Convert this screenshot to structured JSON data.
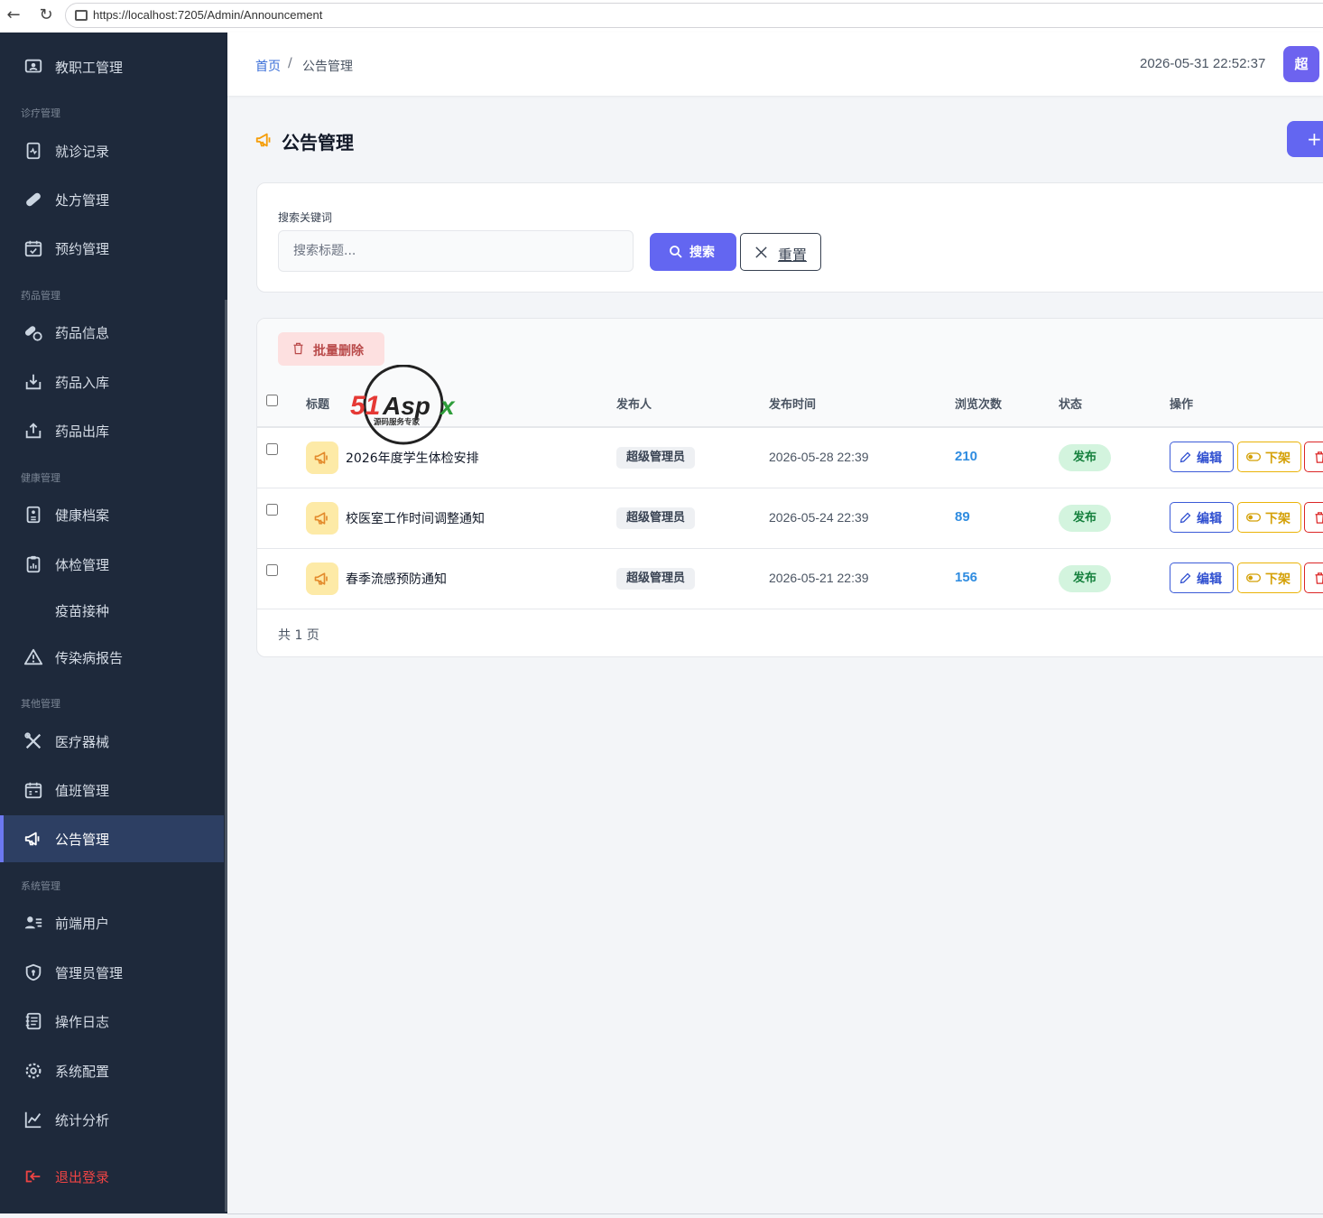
{
  "browser": {
    "url": "https://localhost:7205/Admin/Announcement"
  },
  "sidebar": {
    "items": [
      {
        "label": "教职工管理",
        "icon": "teacher-icon"
      },
      {
        "group": "诊疗管理"
      },
      {
        "label": "就诊记录",
        "icon": "medical-record-icon"
      },
      {
        "label": "处方管理",
        "icon": "capsule-icon"
      },
      {
        "label": "预约管理",
        "icon": "calendar-check-icon"
      },
      {
        "group": "药品管理"
      },
      {
        "label": "药品信息",
        "icon": "pills-icon"
      },
      {
        "label": "药品入库",
        "icon": "box-in-icon"
      },
      {
        "label": "药品出库",
        "icon": "box-out-icon"
      },
      {
        "group": "健康管理"
      },
      {
        "label": "健康档案",
        "icon": "health-file-icon"
      },
      {
        "label": "体检管理",
        "icon": "checkup-icon"
      },
      {
        "label": "疫苗接种",
        "icon": ""
      },
      {
        "label": "传染病报告",
        "icon": "warning-icon"
      },
      {
        "group": "其他管理"
      },
      {
        "label": "医疗器械",
        "icon": "tools-icon"
      },
      {
        "label": "值班管理",
        "icon": "calendar-icon"
      },
      {
        "label": "公告管理",
        "icon": "megaphone-icon",
        "active": true
      },
      {
        "group": "系统管理"
      },
      {
        "label": "前端用户",
        "icon": "users-icon"
      },
      {
        "label": "管理员管理",
        "icon": "shield-icon"
      },
      {
        "label": "操作日志",
        "icon": "log-icon"
      },
      {
        "label": "系统配置",
        "icon": "gear-icon"
      },
      {
        "label": "统计分析",
        "icon": "chart-line-icon"
      },
      {
        "label": "退出登录",
        "icon": "logout-icon"
      }
    ]
  },
  "header": {
    "breadcrumb_home": "首页",
    "breadcrumb_sep": "/",
    "breadcrumb_current": "公告管理",
    "datetime": "2026-05-31 22:52:37",
    "avatar_text": "超"
  },
  "page": {
    "title": "公告管理",
    "add_button": "+"
  },
  "search": {
    "label": "搜索关键词",
    "placeholder": "搜索标题...",
    "value": "",
    "search_button": "搜索",
    "reset_button": "重置"
  },
  "table": {
    "batch_delete": "批量删除",
    "columns": [
      "标题",
      "发布人",
      "发布时间",
      "浏览次数",
      "状态",
      "操作"
    ],
    "rows": [
      {
        "title": "2026年度学生体检安排",
        "publisher": "超级管理员",
        "time": "2026-05-28 22:39",
        "views": "210",
        "status": "发布",
        "edit": "编辑",
        "offline": "下架"
      },
      {
        "title": "校医室工作时间调整通知",
        "publisher": "超级管理员",
        "time": "2026-05-24 22:39",
        "views": "89",
        "status": "发布",
        "edit": "编辑",
        "offline": "下架"
      },
      {
        "title": "春季流感预防通知",
        "publisher": "超级管理员",
        "time": "2026-05-21 22:39",
        "views": "156",
        "status": "发布",
        "edit": "编辑",
        "offline": "下架"
      }
    ],
    "pager": "共 1 页"
  },
  "watermark": {
    "logo_text": "51Aspx",
    "tagline": "源码服务专家"
  },
  "colors": {
    "sidebar_bg": "#1e293b",
    "accent": "#6366f1",
    "active_item": "#2d3f63",
    "status_green": "#15803d",
    "views_blue": "#2f8ce0",
    "danger": "#dc2626",
    "warning": "#eab308"
  }
}
